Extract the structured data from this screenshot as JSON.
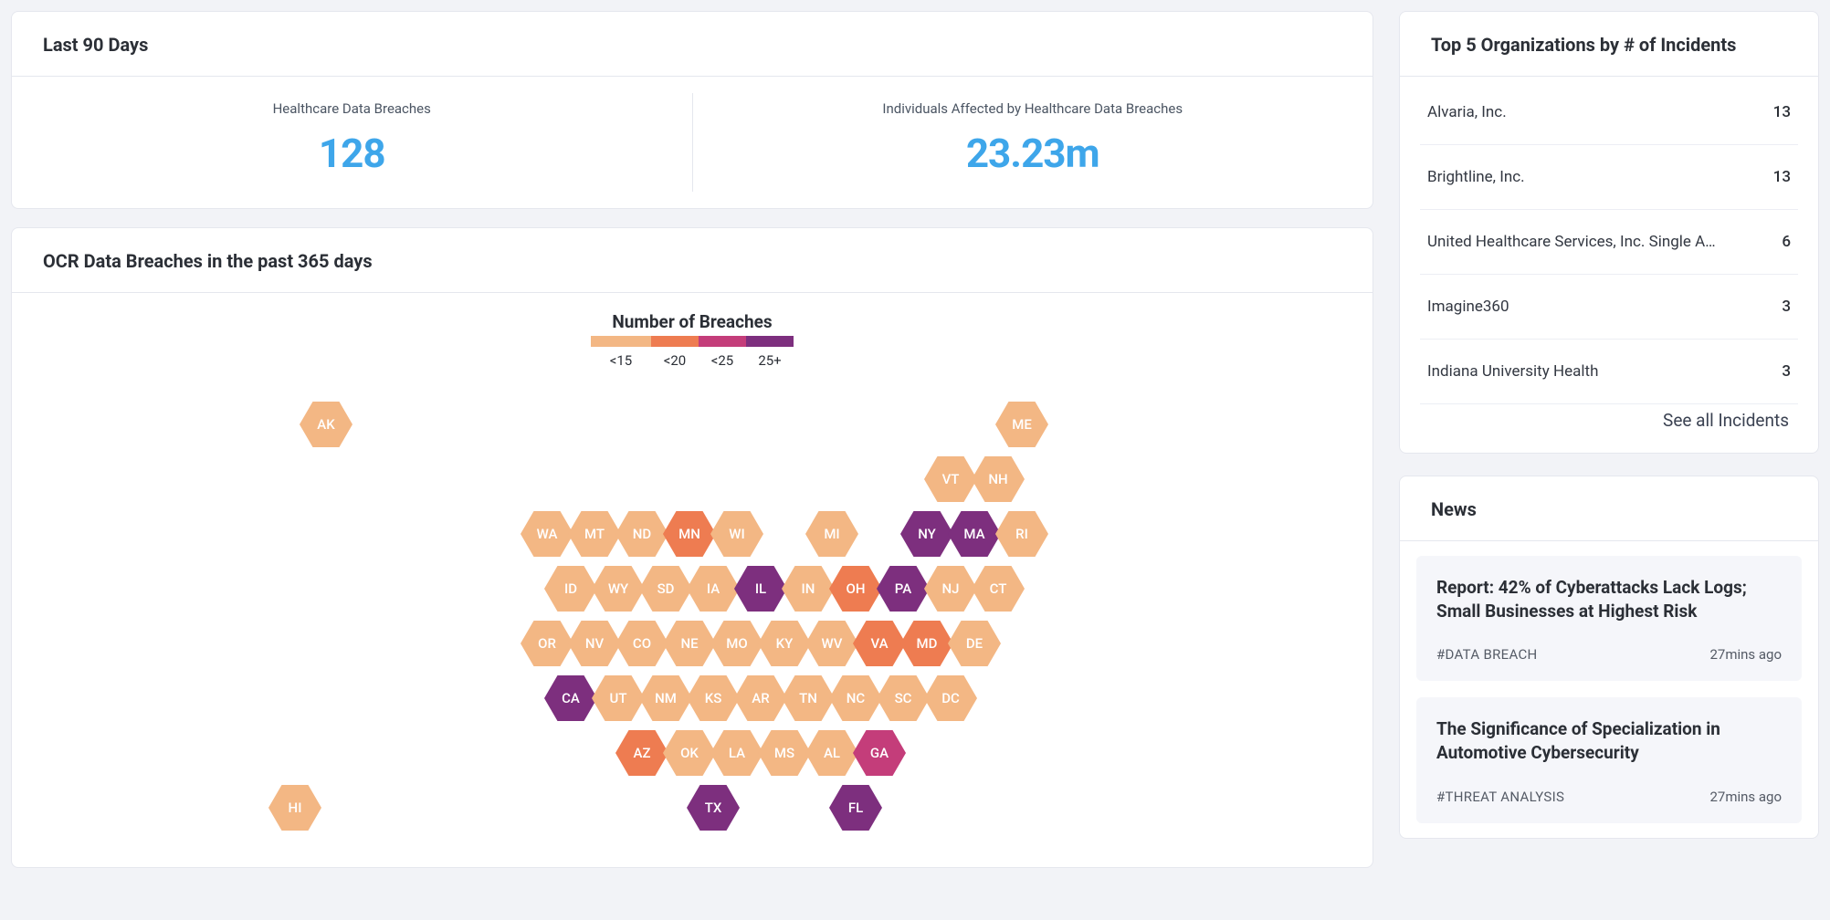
{
  "last90": {
    "title": "Last 90 Days",
    "kpis": [
      {
        "label": "Healthcare Data Breaches",
        "value": "128"
      },
      {
        "label": "Individuals Affected by Healthcare Data Breaches",
        "value": "23.23m"
      }
    ]
  },
  "map": {
    "title": "OCR Data Breaches in the past 365 days",
    "legend_title": "Number of Breaches",
    "legend": [
      "<15",
      "<20",
      "<25",
      "25+"
    ]
  },
  "chart_data": {
    "type": "heatmap",
    "title": "OCR Data Breaches in the past 365 days",
    "legend_bins": [
      {
        "label": "<15",
        "color": "#f3b784"
      },
      {
        "label": "<20",
        "color": "#ee7c51"
      },
      {
        "label": "<25",
        "color": "#c43d7a"
      },
      {
        "label": "25+",
        "color": "#7d2f7e"
      }
    ],
    "note": "bucket index 0..3 maps to legend_bins; row/col are hex-grid positions (odd rows offset right).",
    "states": [
      {
        "code": "AK",
        "row": 0,
        "col": 0,
        "bucket": 0
      },
      {
        "code": "ME",
        "row": 0,
        "col": 11,
        "bucket": 0
      },
      {
        "code": "VT",
        "row": 1,
        "col": 9,
        "bucket": 0
      },
      {
        "code": "NH",
        "row": 1,
        "col": 10,
        "bucket": 0
      },
      {
        "code": "WA",
        "row": 2,
        "col": 1,
        "bucket": 0
      },
      {
        "code": "MT",
        "row": 2,
        "col": 2,
        "bucket": 0
      },
      {
        "code": "ND",
        "row": 2,
        "col": 3,
        "bucket": 0
      },
      {
        "code": "MN",
        "row": 2,
        "col": 4,
        "bucket": 1
      },
      {
        "code": "WI",
        "row": 2,
        "col": 5,
        "bucket": 0
      },
      {
        "code": "MI",
        "row": 2,
        "col": 7,
        "bucket": 0
      },
      {
        "code": "NY",
        "row": 2,
        "col": 9,
        "bucket": 3
      },
      {
        "code": "MA",
        "row": 2,
        "col": 10,
        "bucket": 3
      },
      {
        "code": "RI",
        "row": 2,
        "col": 11,
        "bucket": 0
      },
      {
        "code": "ID",
        "row": 3,
        "col": 1,
        "bucket": 0
      },
      {
        "code": "WY",
        "row": 3,
        "col": 2,
        "bucket": 0
      },
      {
        "code": "SD",
        "row": 3,
        "col": 3,
        "bucket": 0
      },
      {
        "code": "IA",
        "row": 3,
        "col": 4,
        "bucket": 0
      },
      {
        "code": "IL",
        "row": 3,
        "col": 5,
        "bucket": 3
      },
      {
        "code": "IN",
        "row": 3,
        "col": 6,
        "bucket": 0
      },
      {
        "code": "OH",
        "row": 3,
        "col": 7,
        "bucket": 1
      },
      {
        "code": "PA",
        "row": 3,
        "col": 8,
        "bucket": 3
      },
      {
        "code": "NJ",
        "row": 3,
        "col": 9,
        "bucket": 0
      },
      {
        "code": "CT",
        "row": 3,
        "col": 10,
        "bucket": 0
      },
      {
        "code": "OR",
        "row": 4,
        "col": 1,
        "bucket": 0
      },
      {
        "code": "NV",
        "row": 4,
        "col": 2,
        "bucket": 0
      },
      {
        "code": "CO",
        "row": 4,
        "col": 3,
        "bucket": 0
      },
      {
        "code": "NE",
        "row": 4,
        "col": 4,
        "bucket": 0
      },
      {
        "code": "MO",
        "row": 4,
        "col": 5,
        "bucket": 0
      },
      {
        "code": "KY",
        "row": 4,
        "col": 6,
        "bucket": 0
      },
      {
        "code": "WV",
        "row": 4,
        "col": 7,
        "bucket": 0
      },
      {
        "code": "VA",
        "row": 4,
        "col": 8,
        "bucket": 1
      },
      {
        "code": "MD",
        "row": 4,
        "col": 9,
        "bucket": 1
      },
      {
        "code": "DE",
        "row": 4,
        "col": 10,
        "bucket": 0
      },
      {
        "code": "CA",
        "row": 5,
        "col": 1,
        "bucket": 3
      },
      {
        "code": "UT",
        "row": 5,
        "col": 2,
        "bucket": 0
      },
      {
        "code": "NM",
        "row": 5,
        "col": 3,
        "bucket": 0
      },
      {
        "code": "KS",
        "row": 5,
        "col": 4,
        "bucket": 0
      },
      {
        "code": "AR",
        "row": 5,
        "col": 5,
        "bucket": 0
      },
      {
        "code": "TN",
        "row": 5,
        "col": 6,
        "bucket": 0
      },
      {
        "code": "NC",
        "row": 5,
        "col": 7,
        "bucket": 0
      },
      {
        "code": "SC",
        "row": 5,
        "col": 8,
        "bucket": 0
      },
      {
        "code": "DC",
        "row": 5,
        "col": 9,
        "bucket": 0
      },
      {
        "code": "AZ",
        "row": 6,
        "col": 3,
        "bucket": 1
      },
      {
        "code": "OK",
        "row": 6,
        "col": 4,
        "bucket": 0
      },
      {
        "code": "LA",
        "row": 6,
        "col": 5,
        "bucket": 0
      },
      {
        "code": "MS",
        "row": 6,
        "col": 6,
        "bucket": 0
      },
      {
        "code": "AL",
        "row": 6,
        "col": 7,
        "bucket": 0
      },
      {
        "code": "GA",
        "row": 6,
        "col": 8,
        "bucket": 2
      },
      {
        "code": "HI",
        "row": 7,
        "col": -1,
        "bucket": 0
      },
      {
        "code": "TX",
        "row": 7,
        "col": 4,
        "bucket": 3
      },
      {
        "code": "FL",
        "row": 7,
        "col": 7,
        "bucket": 3
      }
    ]
  },
  "top_orgs": {
    "title": "Top 5 Organizations by # of Incidents",
    "rows": [
      {
        "name": "Alvaria, Inc.",
        "count": 13
      },
      {
        "name": "Brightline, Inc.",
        "count": 13
      },
      {
        "name": "United Healthcare Services, Inc. Single Affiliated Cov...",
        "count": 6
      },
      {
        "name": "Imagine360",
        "count": 3
      },
      {
        "name": "Indiana University Health",
        "count": 3
      }
    ],
    "see_all": "See all Incidents"
  },
  "news": {
    "title": "News",
    "items": [
      {
        "title": "Report: 42% of Cyberattacks Lack Logs; Small Businesses at Highest Risk",
        "tag": "#DATA BREACH",
        "age": "27mins ago"
      },
      {
        "title": "The Significance of Specialization in Automotive Cybersecurity",
        "tag": "#THREAT ANALYSIS",
        "age": "27mins ago"
      }
    ]
  }
}
